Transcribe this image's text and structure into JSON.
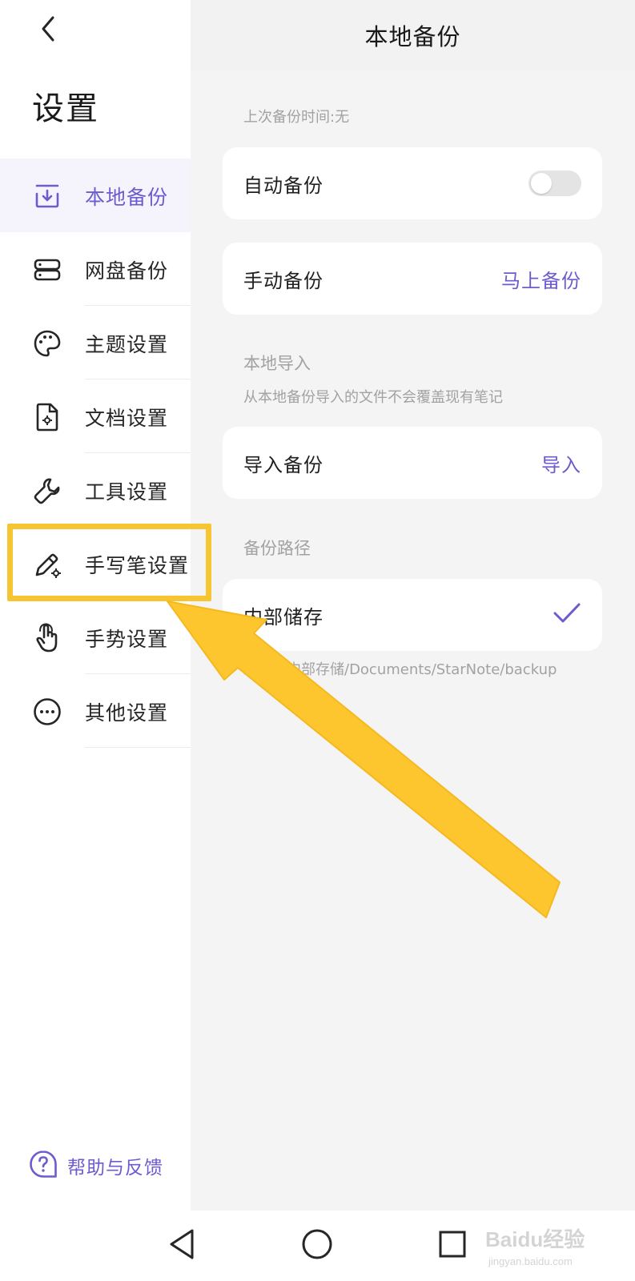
{
  "sidebar": {
    "title": "设置",
    "back_icon": "chevron-left-icon",
    "items": [
      {
        "label": "本地备份",
        "icon": "local-backup-icon",
        "active": true
      },
      {
        "label": "网盘备份",
        "icon": "cloud-drive-icon",
        "active": false
      },
      {
        "label": "主题设置",
        "icon": "palette-icon",
        "active": false
      },
      {
        "label": "文档设置",
        "icon": "document-settings-icon",
        "active": false
      },
      {
        "label": "工具设置",
        "icon": "wrench-icon",
        "active": false
      },
      {
        "label": "手写笔设置",
        "icon": "pen-settings-icon",
        "active": false
      },
      {
        "label": "手势设置",
        "icon": "hand-gesture-icon",
        "active": false
      },
      {
        "label": "其他设置",
        "icon": "more-icon",
        "active": false
      }
    ],
    "help": {
      "label": "帮助与反馈",
      "icon": "help-icon"
    }
  },
  "panel": {
    "title": "本地备份",
    "last_backup": "上次备份时间:无",
    "auto_backup": {
      "label": "自动备份",
      "enabled": false
    },
    "manual_backup": {
      "label": "手动备份",
      "action": "马上备份"
    },
    "import_section": {
      "title": "本地导入",
      "note": "从本地备份导入的文件不会覆盖现有笔记"
    },
    "import_backup": {
      "label": "导入备份",
      "action": "导入"
    },
    "path_section": {
      "title": "备份路径"
    },
    "storage": {
      "label": "内部储存",
      "selected": true,
      "check_icon": "checkmark-icon"
    },
    "path_text": "路径：内部存储/Documents/StarNote/backup"
  },
  "navbar": {
    "buttons": [
      "back-triangle-icon",
      "home-circle-icon",
      "recents-square-icon"
    ]
  },
  "watermark": {
    "text": "Baidu经验",
    "url": "jingyan.baidu.com"
  },
  "colors": {
    "accent": "#6c5ccd",
    "highlight": "#f6c531",
    "panel_bg": "#f4f4f4",
    "active_bg": "#f5f4fd"
  }
}
